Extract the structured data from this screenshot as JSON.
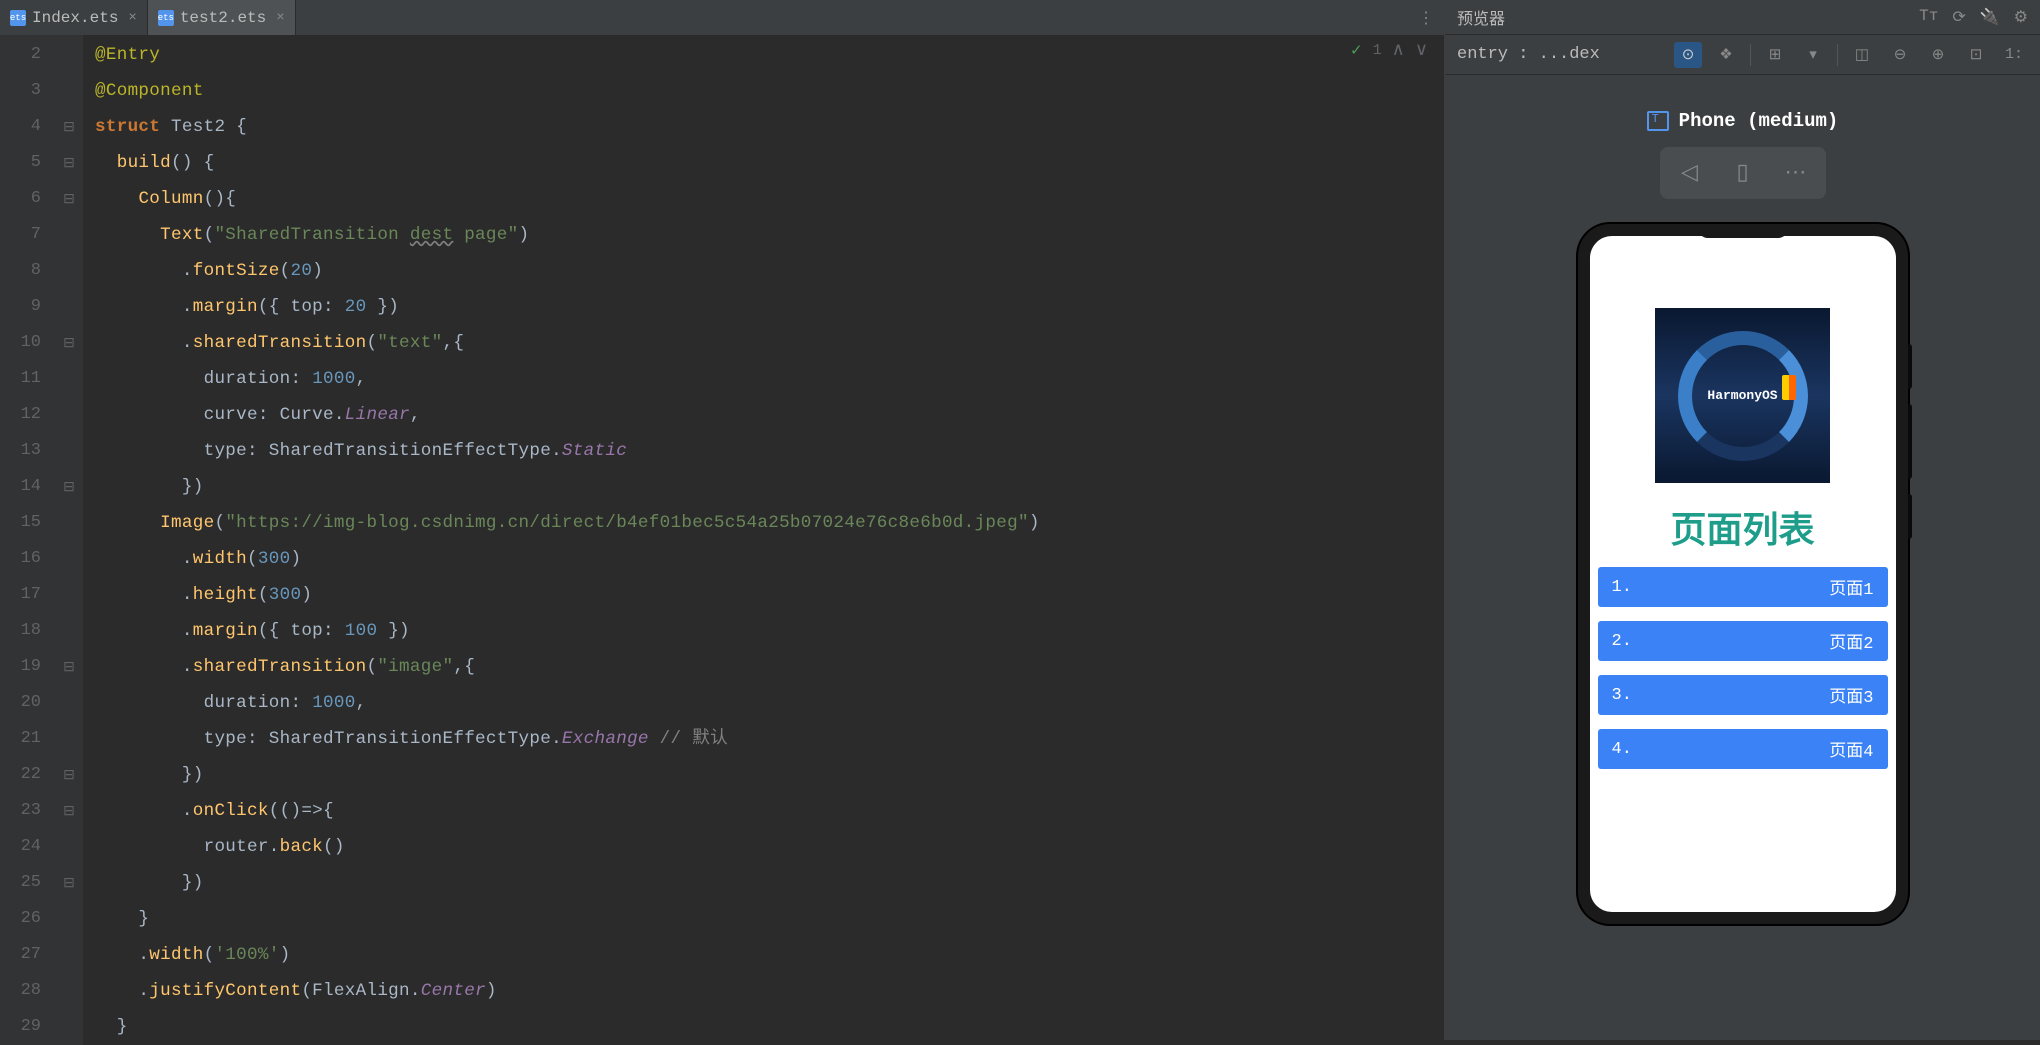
{
  "tabs": [
    {
      "label": "Index.ets",
      "active": false
    },
    {
      "label": "test2.ets",
      "active": true
    }
  ],
  "editor_status": {
    "checkmark": "✓",
    "count": "1"
  },
  "code": {
    "lines": [
      2,
      3,
      4,
      5,
      6,
      7,
      8,
      9,
      10,
      11,
      12,
      13,
      14,
      15,
      16,
      17,
      18,
      19,
      20,
      21,
      22,
      23,
      24,
      25,
      26,
      27,
      28,
      29
    ]
  },
  "tokens": {
    "l2_entry": "@Entry",
    "l3_component": "@Component",
    "l4_struct": "struct",
    "l4_name": "Test2",
    "l4_brace": "{",
    "l5_build": "build",
    "l5_tail": "() {",
    "l6_column": "Column",
    "l6_tail": "(){",
    "l7_text": "Text",
    "l7_open": "(",
    "l7_str1": "\"SharedTransition ",
    "l7_dest": "dest",
    "l7_str2": " page\"",
    "l7_close": ")",
    "l8_dot": ".",
    "l8_font": "fontSize",
    "l8_open": "(",
    "l8_num": "20",
    "l8_close": ")",
    "l9_margin": "margin",
    "l9_top": "top",
    "l9_num": "20",
    "l10_shared": "sharedTransition",
    "l10_str": "\"text\"",
    "l11_duration": "duration",
    "l11_num": "1000",
    "l12_curve": "curve",
    "l12_curveclass": "Curve",
    "l12_linear": "Linear",
    "l13_type": "type",
    "l13_class": "SharedTransitionEffectType",
    "l13_static": "Static",
    "l15_image": "Image",
    "l15_url": "\"https://img-blog.csdnimg.cn/direct/b4ef01bec5c54a25b07024e76c8e6b0d.jpeg\"",
    "l16_width": "width",
    "l16_num": "300",
    "l17_height": "height",
    "l17_num": "300",
    "l18_margin": "margin",
    "l18_top": "top",
    "l18_num": "100",
    "l19_shared": "sharedTransition",
    "l19_str": "\"image\"",
    "l20_duration": "duration",
    "l20_num": "1000",
    "l21_type": "type",
    "l21_class": "SharedTransitionEffectType",
    "l21_exchange": "Exchange",
    "l21_comment": "// 默认",
    "l23_onclick": "onClick",
    "l24_router": "router",
    "l24_back": "back",
    "l27_width": "width",
    "l27_str": "'100%'",
    "l28_justify": "justifyContent",
    "l28_flex": "FlexAlign",
    "l28_center": "Center"
  },
  "preview": {
    "title": "预览器",
    "entry": "entry : ...dex",
    "device": "Phone (medium)",
    "harmony": "HarmonyOS",
    "list_title": "页面列表",
    "items": [
      {
        "num": "1.",
        "label": "页面1"
      },
      {
        "num": "2.",
        "label": "页面2"
      },
      {
        "num": "3.",
        "label": "页面3"
      },
      {
        "num": "4.",
        "label": "页面4"
      }
    ]
  }
}
